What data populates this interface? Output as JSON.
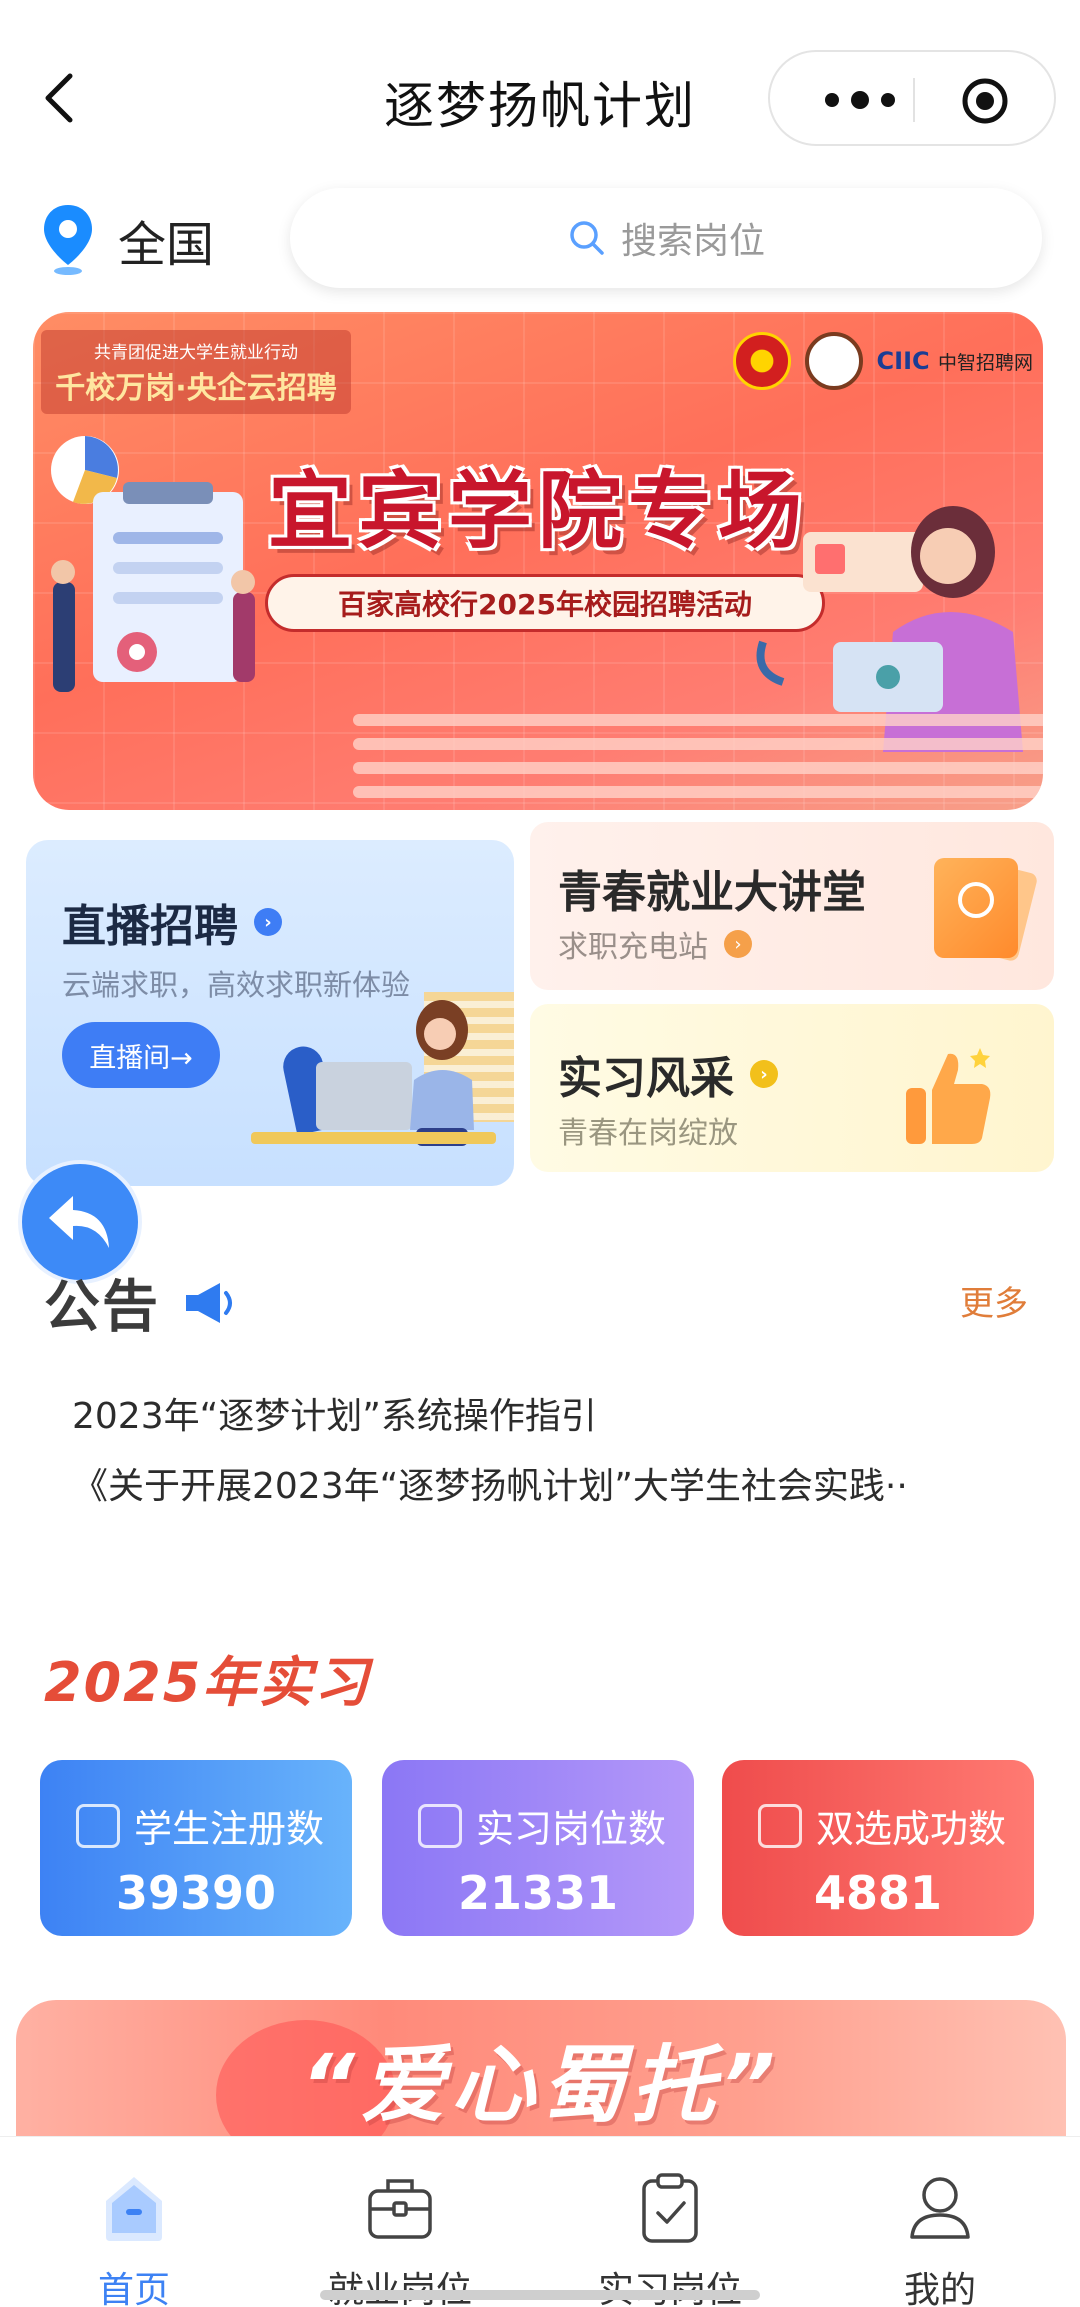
{
  "header": {
    "title": "逐梦扬帆计划"
  },
  "location": {
    "label": "全国"
  },
  "search": {
    "placeholder": "搜索岗位"
  },
  "banner": {
    "tagline_small": "共青团促进大学生就业行动",
    "tagline_big": "千校万岗·央企云招聘",
    "brand": "CIIC",
    "brand_sub": "中智招聘网",
    "headline": "宜宾学院专场",
    "subtitle": "百家高校行2025年校园招聘活动"
  },
  "features": {
    "live": {
      "title": "直播招聘",
      "subtitle": "云端求职，高效求职新体验",
      "button": "直播间→"
    },
    "lecture": {
      "title": "青春就业大讲堂",
      "subtitle": "求职充电站"
    },
    "intern": {
      "title": "实习风采",
      "subtitle": "青春在岗绽放"
    }
  },
  "notices": {
    "title": "公告",
    "more": "更多",
    "items": [
      "2023年“逐梦计划”系统操作指引",
      "《关于开展2023年“逐梦扬帆计划”大学生社会实践··"
    ]
  },
  "stats": {
    "title": "2025年实习",
    "items": [
      {
        "label": "学生注册数",
        "value": "39390"
      },
      {
        "label": "实习岗位数",
        "value": "21331"
      },
      {
        "label": "双选成功数",
        "value": "4881"
      }
    ]
  },
  "promo": {
    "text": "“爱心蜀托”"
  },
  "tabs": [
    {
      "label": "首页",
      "active": true
    },
    {
      "label": "就业岗位",
      "active": false
    },
    {
      "label": "实习岗位",
      "active": false
    },
    {
      "label": "我的",
      "active": false
    }
  ],
  "colors": {
    "accent": "#3d82f4",
    "more_link": "#e07d3a",
    "stats_title": "#e54d38"
  }
}
